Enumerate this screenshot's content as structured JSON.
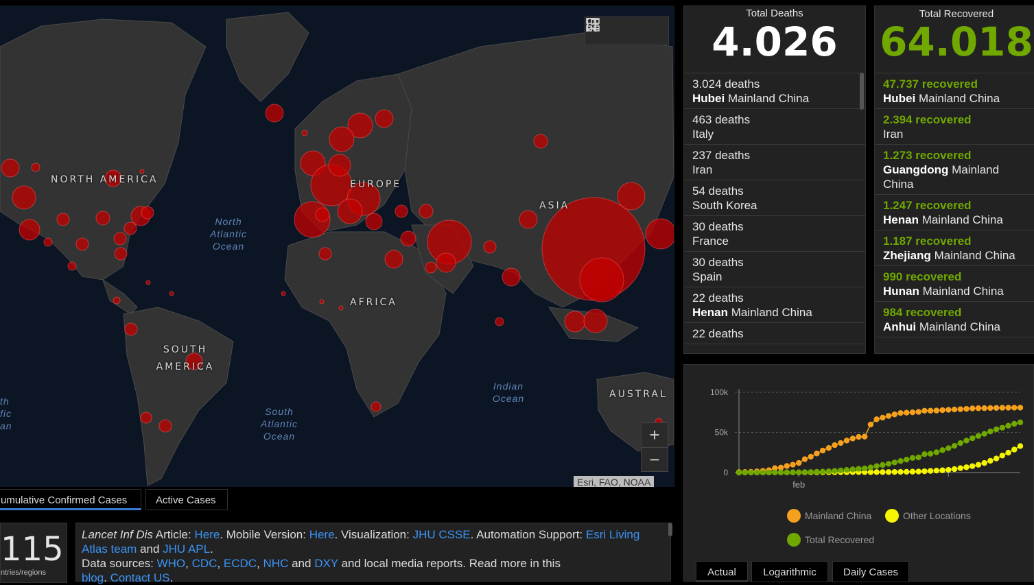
{
  "map": {
    "labels": {
      "north_america": "NORTH AMERICA",
      "europe": "EUROPE",
      "asia": "ASIA",
      "africa": "AFRICA",
      "south_america": "SOUTH AMERICA",
      "australia": "AUSTRAL"
    },
    "oceans": {
      "north_atlantic": "North Atlantic Ocean",
      "south_atlantic": "South Atlantic Ocean",
      "indian": "Indian Ocean",
      "pacific_fragment": "th fic an"
    },
    "attribution": "Esri, FAO, NOAA",
    "zoom_in": "+",
    "zoom_out": "−",
    "tools": [
      "bookmark-icon",
      "list-icon",
      "grid-icon"
    ]
  },
  "tabs": {
    "cumulative": "umulative Confirmed Cases",
    "active": "Active Cases"
  },
  "counter": {
    "value": "115",
    "label": "ntries/regions"
  },
  "info": {
    "t1": "Lancet Inf Dis",
    "t2": " Article: ",
    "l_here1": "Here",
    "t3": ". Mobile Version: ",
    "l_here2": "Here",
    "t4": ". Visualization: ",
    "l_jhu": "JHU CSSE",
    "t5": ". Automation Support: ",
    "l_esri": "Esri Living Atlas team",
    "t6": " and ",
    "l_apl": "JHU APL",
    "t7": ".",
    "t8": "Data sources: ",
    "l_who": "WHO",
    "c1": ", ",
    "l_cdc": "CDC",
    "c2": ", ",
    "l_ecdc": "ECDC",
    "c3": ", ",
    "l_nhc": "NHC",
    "t9": " and ",
    "l_dxy": "DXY",
    "t10": " and local media reports. Read more in this",
    "l_blog": "blog",
    "c4": ". ",
    "l_contact": "Contact US",
    "c5": "."
  },
  "deaths": {
    "title": "Total Deaths",
    "total": "4.026",
    "items": [
      {
        "count": "3.024 deaths",
        "bold": "Hubei",
        "place": " Mainland China"
      },
      {
        "count": "463 deaths",
        "bold": "",
        "place": " Italy"
      },
      {
        "count": "237 deaths",
        "bold": "",
        "place": " Iran"
      },
      {
        "count": "54 deaths",
        "bold": "",
        "place": " South Korea"
      },
      {
        "count": "30 deaths",
        "bold": "",
        "place": " France"
      },
      {
        "count": "30 deaths",
        "bold": "",
        "place": " Spain"
      },
      {
        "count": "22 deaths",
        "bold": "Henan",
        "place": " Mainland China"
      },
      {
        "count": "22 deaths",
        "bold": "",
        "place": ""
      }
    ]
  },
  "recovered": {
    "title": "Total Recovered",
    "total": "64.018",
    "items": [
      {
        "count": "47.737 recovered",
        "bold": "Hubei",
        "place": " Mainland China"
      },
      {
        "count": "2.394 recovered",
        "bold": "",
        "place": " Iran"
      },
      {
        "count": "1.273 recovered",
        "bold": "Guangdong",
        "place": " Mainland China"
      },
      {
        "count": "1.247 recovered",
        "bold": "Henan",
        "place": " Mainland China"
      },
      {
        "count": "1.187 recovered",
        "bold": "Zhejiang",
        "place": " Mainland China"
      },
      {
        "count": "990 recovered",
        "bold": "Hunan",
        "place": " Mainland China"
      },
      {
        "count": "984 recovered",
        "bold": "Anhui",
        "place": " Mainland China"
      }
    ]
  },
  "chart_tabs": {
    "actual": "Actual",
    "log": "Logarithmic",
    "daily": "Daily Cases"
  },
  "colors": {
    "china": "#f6a11d",
    "other": "#f5f500",
    "recovered": "#70a800",
    "bubble": "#c40000"
  },
  "chart_data": {
    "type": "line",
    "yticks": [
      "100k",
      "50k",
      "0"
    ],
    "xticks": [
      "feb"
    ],
    "ylim": [
      0,
      100000
    ],
    "series": [
      {
        "name": "Mainland China",
        "color": "#f6a11d",
        "values": [
          548,
          643,
          920,
          1406,
          2075,
          2877,
          5509,
          6087,
          8141,
          9802,
          11891,
          16630,
          19716,
          23707,
          27440,
          30587,
          34110,
          36814,
          39829,
          42354,
          44386,
          44759,
          59895,
          66358,
          68413,
          70513,
          72434,
          74211,
          74619,
          75077,
          75550,
          77001,
          77022,
          77241,
          77754,
          78166,
          78600,
          78928,
          79356,
          79932,
          80136,
          80261,
          80386,
          80537,
          80690,
          80770,
          80823,
          80860
        ]
      },
      {
        "name": "Other Locations",
        "color": "#f5f500",
        "values": [
          7,
          8,
          12,
          16,
          21,
          49,
          74,
          96,
          123,
          146,
          153,
          174,
          195,
          221,
          270,
          309,
          341,
          398,
          444,
          490,
          505,
          524,
          532,
          534,
          547,
          630,
          731,
          790,
          931,
          1087,
          1257,
          1589,
          2007,
          2410,
          2785,
          3384,
          4294,
          5462,
          6612,
          7986,
          9653,
          11879,
          14626,
          17464,
          21157,
          24747,
          28629,
          33000
        ]
      },
      {
        "name": "Total Recovered",
        "color": "#70a800",
        "values": [
          28,
          30,
          36,
          39,
          52,
          61,
          107,
          126,
          143,
          222,
          284,
          472,
          623,
          852,
          1124,
          1487,
          2011,
          2616,
          3244,
          3946,
          4683,
          5150,
          6295,
          8058,
          9395,
          10865,
          12583,
          14352,
          16121,
          18177,
          18890,
          22886,
          23394,
          25227,
          27905,
          30384,
          33277,
          36711,
          39782,
          42716,
          45602,
          48228,
          51170,
          53796,
          55865,
          58358,
          60694,
          62512
        ]
      }
    ]
  }
}
